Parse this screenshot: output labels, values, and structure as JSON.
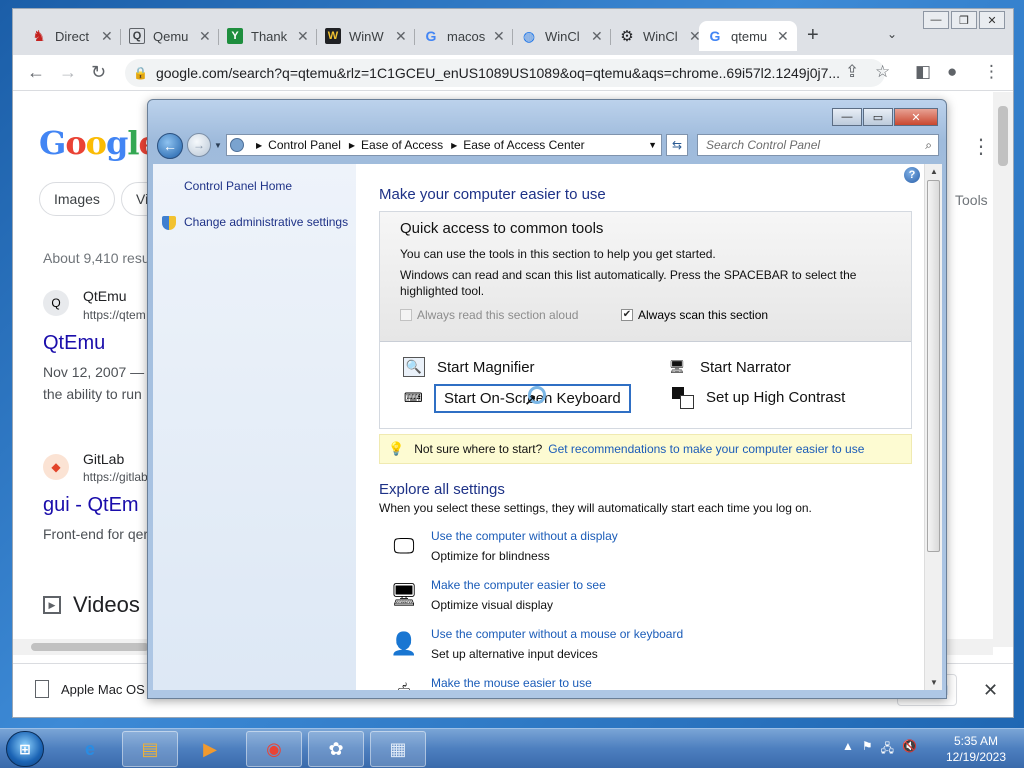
{
  "browser": {
    "tabs": [
      {
        "title": "Direct",
        "icon": "red-bird-icon",
        "color": "#c5221f"
      },
      {
        "title": "Qemu",
        "icon": "qemu-icon",
        "color": "#5f6368"
      },
      {
        "title": "Thank",
        "icon": "green-y-icon",
        "color": "#1e8e3e"
      },
      {
        "title": "WinW",
        "icon": "winworld-icon",
        "color": "#202124"
      },
      {
        "title": "macos",
        "icon": "google-icon",
        "color": "#4285f4"
      },
      {
        "title": "WinCl",
        "icon": "globe-icon",
        "color": "#1a73e8"
      },
      {
        "title": "WinCl",
        "icon": "gear-icon",
        "color": "#202124"
      },
      {
        "title": "qtemu",
        "icon": "google-icon",
        "color": "#4285f4"
      }
    ],
    "new_tab_symbol": "+",
    "tab_menu_symbol": "⌄",
    "url": "google.com/search?q=qtemu&rlz=1C1GCEU_enUS1089US1089&oq=qtemu&aqs=chrome..69i57l2.1249j0j7..."
  },
  "google": {
    "logo": "Google",
    "chips": [
      "Images",
      "Vi"
    ],
    "tools_label": "Tools",
    "about": "About 9,410 resu",
    "results": [
      {
        "site": "QtEmu",
        "url": "https://qtem",
        "title": "QtEmu",
        "snippet1": "Nov 12, 2007 —",
        "snippet2": "the ability to run"
      },
      {
        "site": "GitLab",
        "url": "https://gitlab",
        "title": "gui - QtEm",
        "snippet1": "Front-end for qer",
        "snippet2": ""
      }
    ],
    "videos_label": "Videos"
  },
  "download_bar": {
    "file": "Apple Mac OS",
    "show_all": "all",
    "close_symbol": "✕"
  },
  "control_panel": {
    "breadcrumbs": [
      "Control Panel",
      "Ease of Access",
      "Ease of Access Center"
    ],
    "search_placeholder": "Search Control Panel",
    "left_links": [
      "Control Panel Home",
      "Change administrative settings"
    ],
    "heading": "Make your computer easier to use",
    "quick_access": {
      "title": "Quick access to common tools",
      "text1": "You can use the tools in this section to help you get started.",
      "text2": "Windows can read and scan this list automatically.  Press the SPACEBAR to select the highlighted tool.",
      "read_aloud_label": "Always read this section aloud",
      "read_aloud_checked": false,
      "scan_label": "Always scan this section",
      "scan_checked": true,
      "tools": {
        "magnifier": "Start Magnifier",
        "narrator": "Start Narrator",
        "keyboard": "Start On-Screen Keyboard",
        "contrast": "Set up High Contrast"
      }
    },
    "tip": {
      "text": "Not sure where to start?",
      "link": "Get recommendations to make your computer easier to use"
    },
    "explore": {
      "heading": "Explore all settings",
      "subtitle": "When you select these settings, they will automatically start each time you log on.",
      "items": [
        {
          "link": "Use the computer without a display",
          "desc": "Optimize for blindness",
          "icon": "display-blind-icon"
        },
        {
          "link": "Make the computer easier to see",
          "desc": "Optimize visual display",
          "icon": "monitor-icon"
        },
        {
          "link": "Use the computer without a mouse or keyboard",
          "desc": "Set up alternative input devices",
          "icon": "person-icon"
        },
        {
          "link": "Make the mouse easier to use",
          "desc": "",
          "icon": "mouse-icon"
        }
      ]
    }
  },
  "taskbar": {
    "start_symbol": "⊞",
    "items": [
      "internet-explorer-icon",
      "explorer-icon",
      "media-player-icon",
      "chrome-icon",
      "qemu-app-icon",
      "control-panel-icon"
    ],
    "time": "5:35 AM",
    "date": "12/19/2023"
  }
}
